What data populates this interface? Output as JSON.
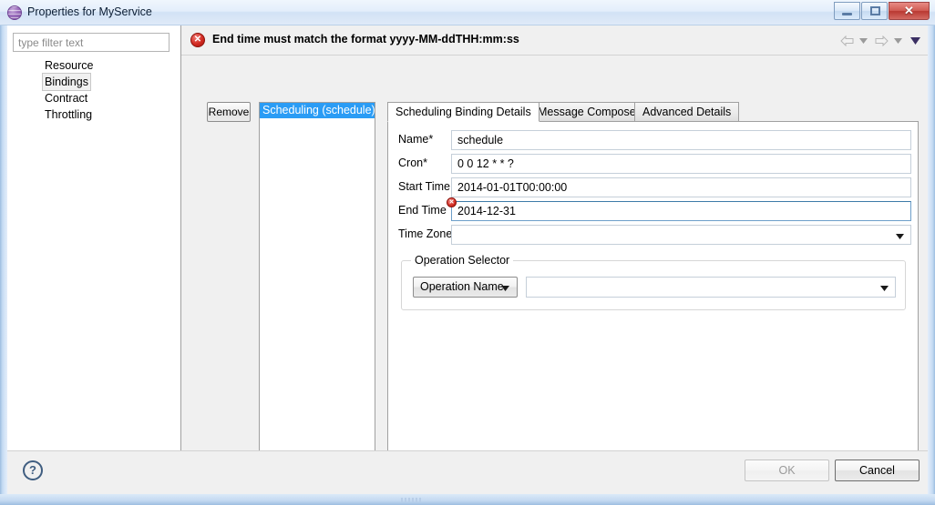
{
  "window": {
    "title": "Properties for MyService",
    "icon": "properties-sphere-icon",
    "controls": {
      "minimize": "minimize-icon",
      "maximize": "restore-icon",
      "close": "✕"
    }
  },
  "sidebar": {
    "filter_placeholder": "type filter text",
    "filter_value": "",
    "items": [
      {
        "label": "Resource",
        "selected": false
      },
      {
        "label": "Bindings",
        "selected": true
      },
      {
        "label": "Contract",
        "selected": false
      },
      {
        "label": "Throttling",
        "selected": false
      }
    ]
  },
  "error_banner": {
    "icon": "error-icon",
    "glyph": "✕",
    "message": "End time must match the format yyyy-MM-ddTHH:mm:ss",
    "nav": {
      "back": "back-arrow-icon",
      "back_menu": "chevron-down-icon",
      "forward": "forward-arrow-icon",
      "forward_menu": "chevron-down-icon",
      "menu": "chevron-down-icon"
    }
  },
  "bindings": {
    "remove_label": "Remove",
    "list": [
      {
        "label": "Scheduling (schedule)",
        "selected": true
      }
    ]
  },
  "tabs": [
    {
      "label": "Scheduling Binding Details",
      "active": true
    },
    {
      "label": "Message Composer",
      "active": false
    },
    {
      "label": "Advanced Details",
      "active": false
    }
  ],
  "form": {
    "name": {
      "label": "Name*",
      "value": "schedule"
    },
    "cron": {
      "label": "Cron*",
      "value": "0 0 12 * * ?"
    },
    "start_time": {
      "label": "Start Time",
      "value": "2014-01-01T00:00:00"
    },
    "end_time": {
      "label": "End Time",
      "value": "2014-12-31",
      "error_glyph": "✕"
    },
    "time_zone": {
      "label": "Time Zone",
      "value": ""
    }
  },
  "operation_selector": {
    "title": "Operation Selector",
    "type_button": "Operation Name",
    "value": ""
  },
  "footer": {
    "help_glyph": "?",
    "ok_label": "OK",
    "cancel_label": "Cancel"
  },
  "colors": {
    "selection_blue": "#2a9cf5",
    "error_red": "#d22a22",
    "titlebar_blue": "#dfeaf8",
    "close_red": "#c0392f"
  }
}
